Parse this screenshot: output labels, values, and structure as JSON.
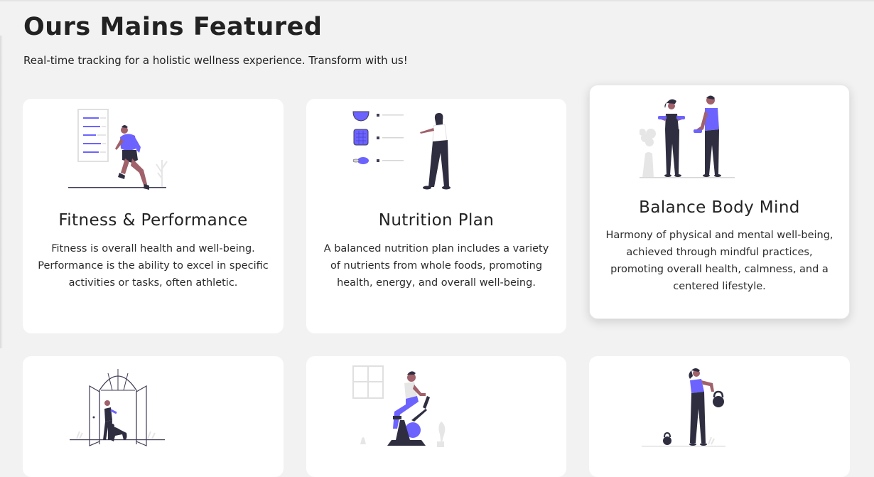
{
  "section": {
    "title": "Ours Mains Featured",
    "subtitle": "Real-time tracking for a holistic wellness experience. Transform with us!"
  },
  "colors": {
    "accent": "#6c63ff",
    "dark": "#2f2e41",
    "skin": "#a0616a",
    "muted": "#e6e6e6",
    "background": "#f2f2f2"
  },
  "features": [
    {
      "title": "Fitness & Performance",
      "description": "Fitness is overall health and well-being. Performance is the ability to excel in specific activities or tasks, often athletic.",
      "icon": "runner-illustration"
    },
    {
      "title": "Nutrition Plan",
      "description": "A balanced nutrition plan includes a variety of nutrients from whole foods, promoting health, energy, and overall well-being.",
      "icon": "nutrition-illustration"
    },
    {
      "title": "Balance Body Mind",
      "description": "Harmony of physical and mental well-being, achieved through mindful practices, promoting overall health, calmness, and a centered lifestyle.",
      "icon": "workout-partners-illustration"
    },
    {
      "title": "",
      "description": "",
      "icon": "dog-walk-illustration"
    },
    {
      "title": "",
      "description": "",
      "icon": "stationary-bike-illustration"
    },
    {
      "title": "",
      "description": "",
      "icon": "kettlebell-illustration"
    }
  ]
}
